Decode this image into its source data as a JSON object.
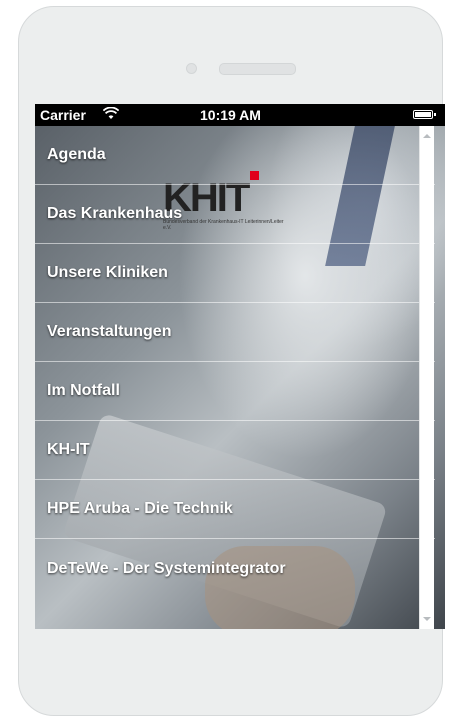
{
  "status_bar": {
    "carrier": "Carrier",
    "time": "10:19 AM",
    "wifi_icon": "wifi-icon",
    "battery_icon": "battery-icon"
  },
  "logo": {
    "text": "KHIT",
    "tagline": "Bundesverband der Krankenhaus-IT Leiterinnen/Leiter e.V.",
    "accent_color": "#e0001a"
  },
  "menu": {
    "items": [
      {
        "label": "Agenda",
        "chevron": "›"
      },
      {
        "label": "Das Krankenhaus",
        "chevron": "›"
      },
      {
        "label": "Unsere Kliniken",
        "chevron": "›"
      },
      {
        "label": "Veranstaltungen",
        "chevron": "›"
      },
      {
        "label": "Im Notfall",
        "chevron": "›"
      },
      {
        "label": "KH-IT",
        "chevron": "›"
      },
      {
        "label": "HPE Aruba - Die Technik",
        "chevron": "›"
      },
      {
        "label": "DeTeWe - Der Systemintegrator",
        "chevron": "›"
      }
    ]
  }
}
